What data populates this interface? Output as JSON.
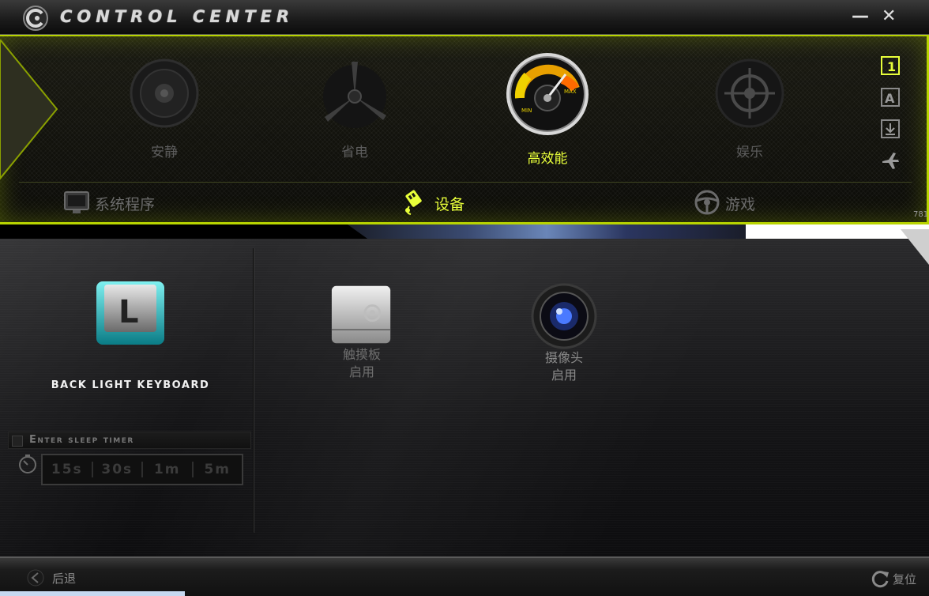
{
  "window": {
    "title": "CONTROL CENTER",
    "minimize_label": "—",
    "close_label": "✕"
  },
  "modes": [
    {
      "label": "安静",
      "icon": "speaker-icon",
      "active": false
    },
    {
      "label": "省电",
      "icon": "fan-icon",
      "active": false
    },
    {
      "label": "高效能",
      "icon": "speedometer-icon",
      "active": true
    },
    {
      "label": "娱乐",
      "icon": "crosshair-icon",
      "active": false
    }
  ],
  "side_icons": [
    {
      "name": "profile-1-icon",
      "label": "1"
    },
    {
      "name": "font-a-icon",
      "label": "A"
    },
    {
      "name": "download-icon",
      "label": ""
    },
    {
      "name": "airplane-mode-icon",
      "label": ""
    }
  ],
  "categories": [
    {
      "label": "系统程序",
      "icon": "monitor-icon",
      "active": false
    },
    {
      "label": "设备",
      "icon": "usb-plug-icon",
      "active": true
    },
    {
      "label": "游戏",
      "icon": "steering-wheel-icon",
      "active": false
    }
  ],
  "coords": {
    "top": "781",
    "bottom": "723"
  },
  "keyboard": {
    "icon_letter": "L",
    "label": "BACK LIGHT KEYBOARD"
  },
  "sleep_timer": {
    "title": "Enter sleep timer",
    "options": [
      "15s",
      "30s",
      "1m",
      "5m"
    ]
  },
  "devices": [
    {
      "name": "触摸板",
      "status": "启用",
      "icon": "touchpad-icon"
    },
    {
      "name": "摄像头",
      "status": "启用",
      "icon": "camera-icon"
    }
  ],
  "bottom": {
    "back_label": "后退",
    "reset_label": "复位"
  },
  "colors": {
    "accent": "#b8d400",
    "active_text": "#e8ff3a",
    "inactive_text": "#5d5d5d"
  }
}
